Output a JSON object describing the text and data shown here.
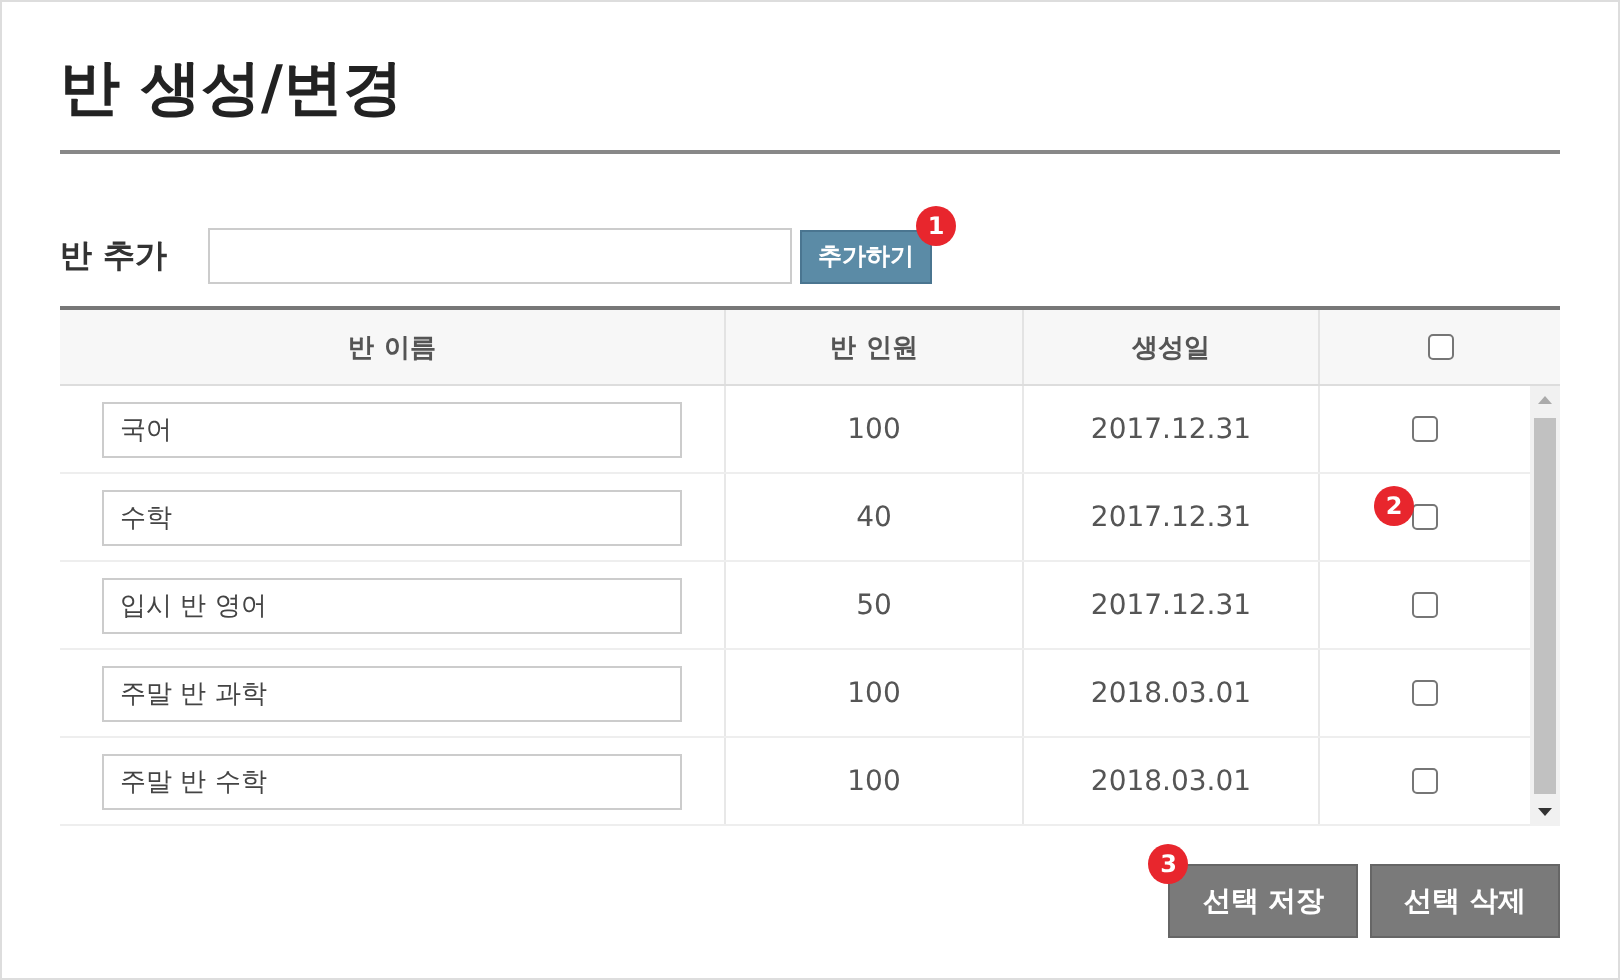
{
  "title": "반 생성/변경",
  "add_form": {
    "label": "반 추가",
    "button": "추가하기",
    "badge": "1"
  },
  "table": {
    "columns": [
      {
        "label": "반 이름",
        "kind": "text"
      },
      {
        "label": "반 인원",
        "kind": "text"
      },
      {
        "label": "생성일",
        "kind": "text"
      },
      {
        "kind": "checkbox",
        "checked": false
      }
    ],
    "rows": [
      {
        "name": "국어",
        "count": "100",
        "date": "2017.12.31",
        "checked": false
      },
      {
        "name": "수학",
        "count": "40",
        "date": "2017.12.31",
        "checked": false,
        "badge": "2"
      },
      {
        "name": "입시 반 영어",
        "count": "50",
        "date": "2017.12.31",
        "checked": false
      },
      {
        "name": "주말 반 과학",
        "count": "100",
        "date": "2018.03.01",
        "checked": false
      },
      {
        "name": "주말 반 수학",
        "count": "100",
        "date": "2018.03.01",
        "checked": false
      }
    ]
  },
  "actions": [
    {
      "label": "선택 저장",
      "badge": "3"
    },
    {
      "label": "선택 삭제"
    }
  ]
}
